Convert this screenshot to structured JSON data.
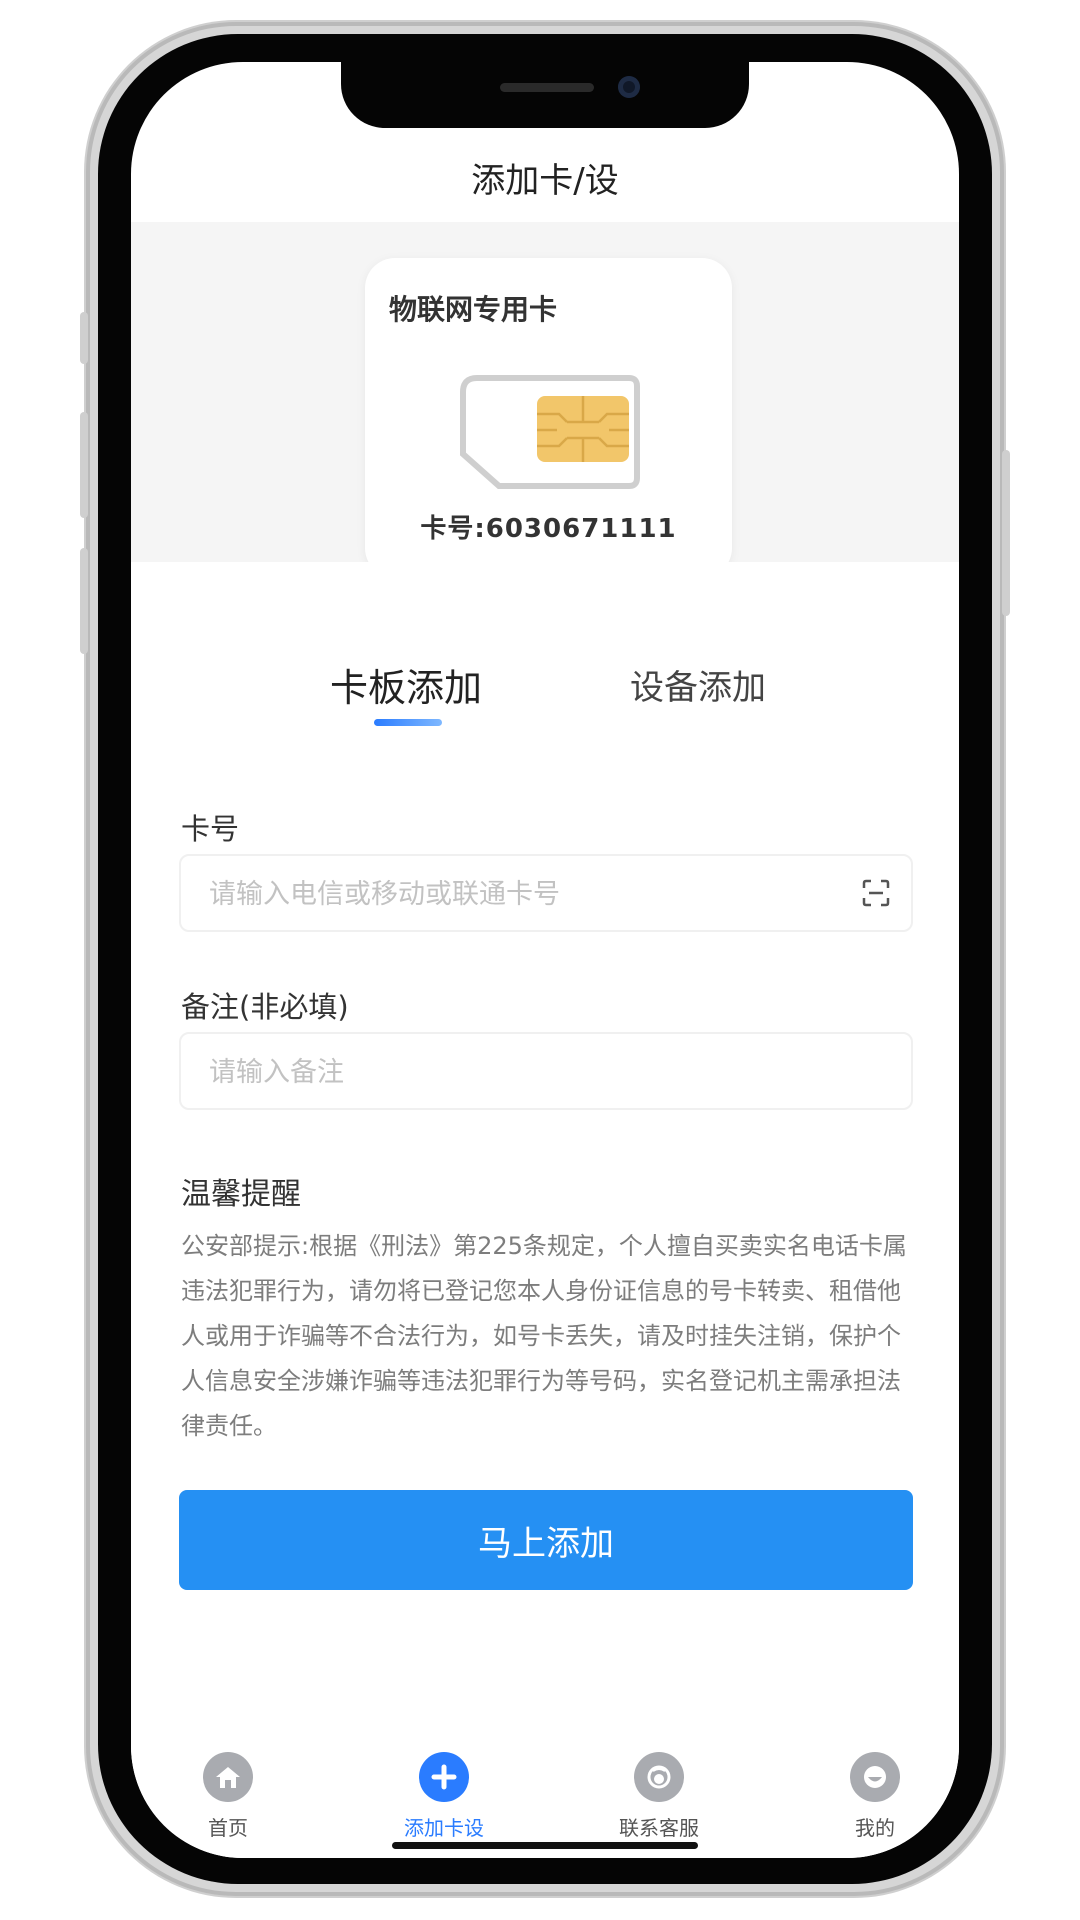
{
  "header": {
    "title": "添加卡/设"
  },
  "card": {
    "title": "物联网专用卡",
    "number": "卡号:6030671111"
  },
  "tabs": [
    {
      "label": "卡板添加",
      "active": true
    },
    {
      "label": "设备添加",
      "active": false
    }
  ],
  "form": {
    "card_label": "卡号",
    "card_placeholder": "请输入电信或移动或联通卡号",
    "remark_label": "备注(非必填)",
    "remark_placeholder": "请输入备注"
  },
  "tips": {
    "title": "温馨提醒",
    "text": "公安部提示:根据《刑法》第225条规定，个人擅自买卖实名电话卡属违法犯罪行为，请勿将已登记您本人身份证信息的号卡转卖、租借他人或用于诈骗等不合法行为，如号卡丢失，请及时挂失注销，保护个人信息安全涉嫌诈骗等违法犯罪行为等号码，实名登记机主需承担法律责任。"
  },
  "submit_label": "马上添加",
  "bottom_nav": [
    {
      "label": "首页",
      "icon": "home-icon",
      "active": false
    },
    {
      "label": "添加卡设",
      "icon": "plus-icon",
      "active": true
    },
    {
      "label": "联系客服",
      "icon": "customer-service-icon",
      "active": false
    },
    {
      "label": "我的",
      "icon": "profile-icon",
      "active": false
    }
  ],
  "colors": {
    "accent": "#2590f3",
    "active_tab": "#2a7cff",
    "icon_gray": "#a9abb0"
  }
}
